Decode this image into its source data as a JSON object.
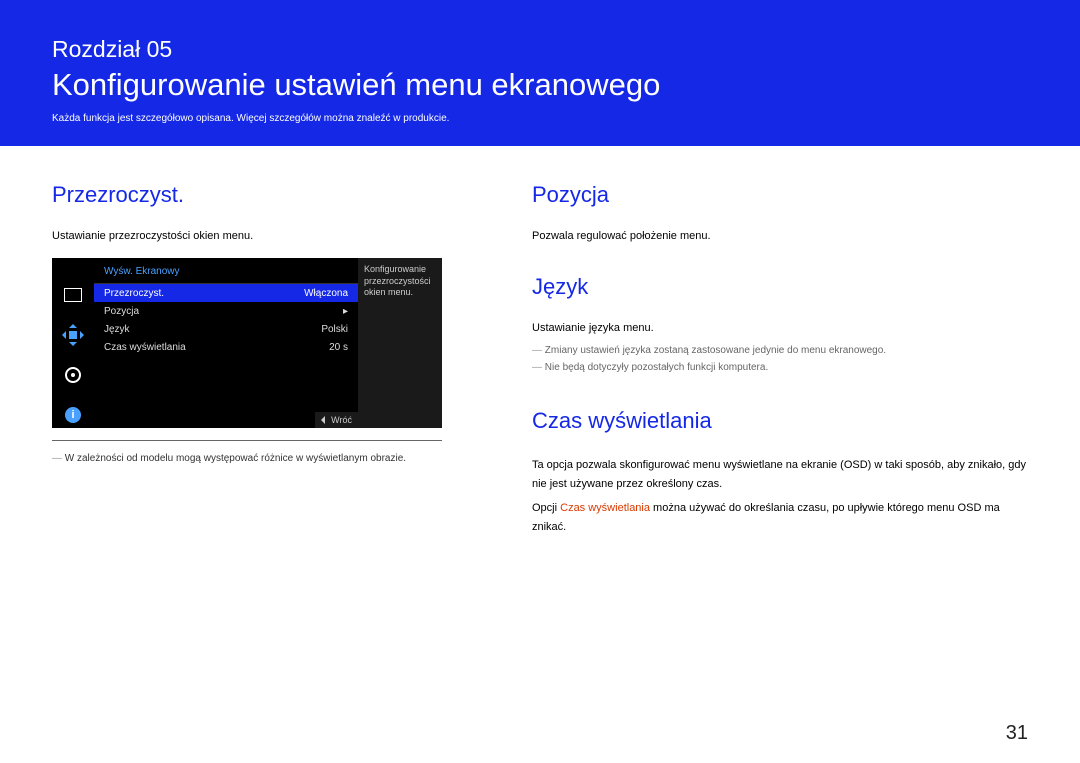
{
  "banner": {
    "chapter": "Rozdział 05",
    "title": "Konfigurowanie ustawień menu ekranowego",
    "desc": "Każda funkcja jest szczegółowo opisana. Więcej szczegółów można znaleźć w produkcie."
  },
  "left": {
    "heading": "Przezroczyst.",
    "desc": "Ustawianie przezroczystości okien menu.",
    "footnote": "W zależności od modelu mogą występować różnice w wyświetlanym obrazie."
  },
  "osd_menu": {
    "header": "Wyśw. Ekranowy",
    "panel_desc": "Konfigurowanie przezroczystości okien menu.",
    "rows": [
      {
        "label": "Przezroczyst.",
        "value": "Włączona",
        "selected": true
      },
      {
        "label": "Pozycja",
        "value": "▸",
        "selected": false
      },
      {
        "label": "Język",
        "value": "Polski",
        "selected": false
      },
      {
        "label": "Czas wyświetlania",
        "value": "20 s",
        "selected": false
      }
    ],
    "footer": "Wróć",
    "info_glyph": "i"
  },
  "right": {
    "pozycja": {
      "heading": "Pozycja",
      "desc": "Pozwala regulować położenie menu."
    },
    "jezyk": {
      "heading": "Język",
      "desc": "Ustawianie języka menu.",
      "note1": "Zmiany ustawień języka zostaną zastosowane jedynie do menu ekranowego.",
      "note2": "Nie będą dotyczyły pozostałych funkcji komputera."
    },
    "czas": {
      "heading": "Czas wyświetlania",
      "p1": "Ta opcja pozwala skonfigurować menu wyświetlane na ekranie (OSD) w taki sposób, aby znikało, gdy nie jest używane przez określony czas.",
      "p2_pre": "Opcji ",
      "p2_ref": "Czas wyświetlania",
      "p2_post": " można używać do określania czasu, po upływie którego menu OSD ma znikać."
    }
  },
  "page_number": "31"
}
